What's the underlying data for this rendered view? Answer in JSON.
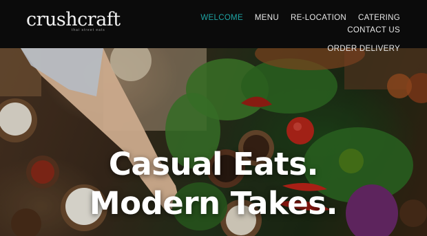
{
  "brand": {
    "name": "crushcraft",
    "tagline": "thai street eats"
  },
  "nav": {
    "items": [
      {
        "label": "WELCOME",
        "active": true
      },
      {
        "label": "MENU",
        "active": false
      },
      {
        "label": "RE-LOCATION",
        "active": false
      },
      {
        "label": "CATERING",
        "active": false
      },
      {
        "label": "CONTACT US",
        "active": false
      },
      {
        "label": "ORDER DELIVERY",
        "active": false
      }
    ]
  },
  "hero": {
    "line1": "Casual Eats.",
    "line2": "Modern Takes."
  },
  "colors": {
    "accent": "#1fa5a5",
    "header_bg": "#0b0b0b",
    "text": "#ffffff"
  }
}
